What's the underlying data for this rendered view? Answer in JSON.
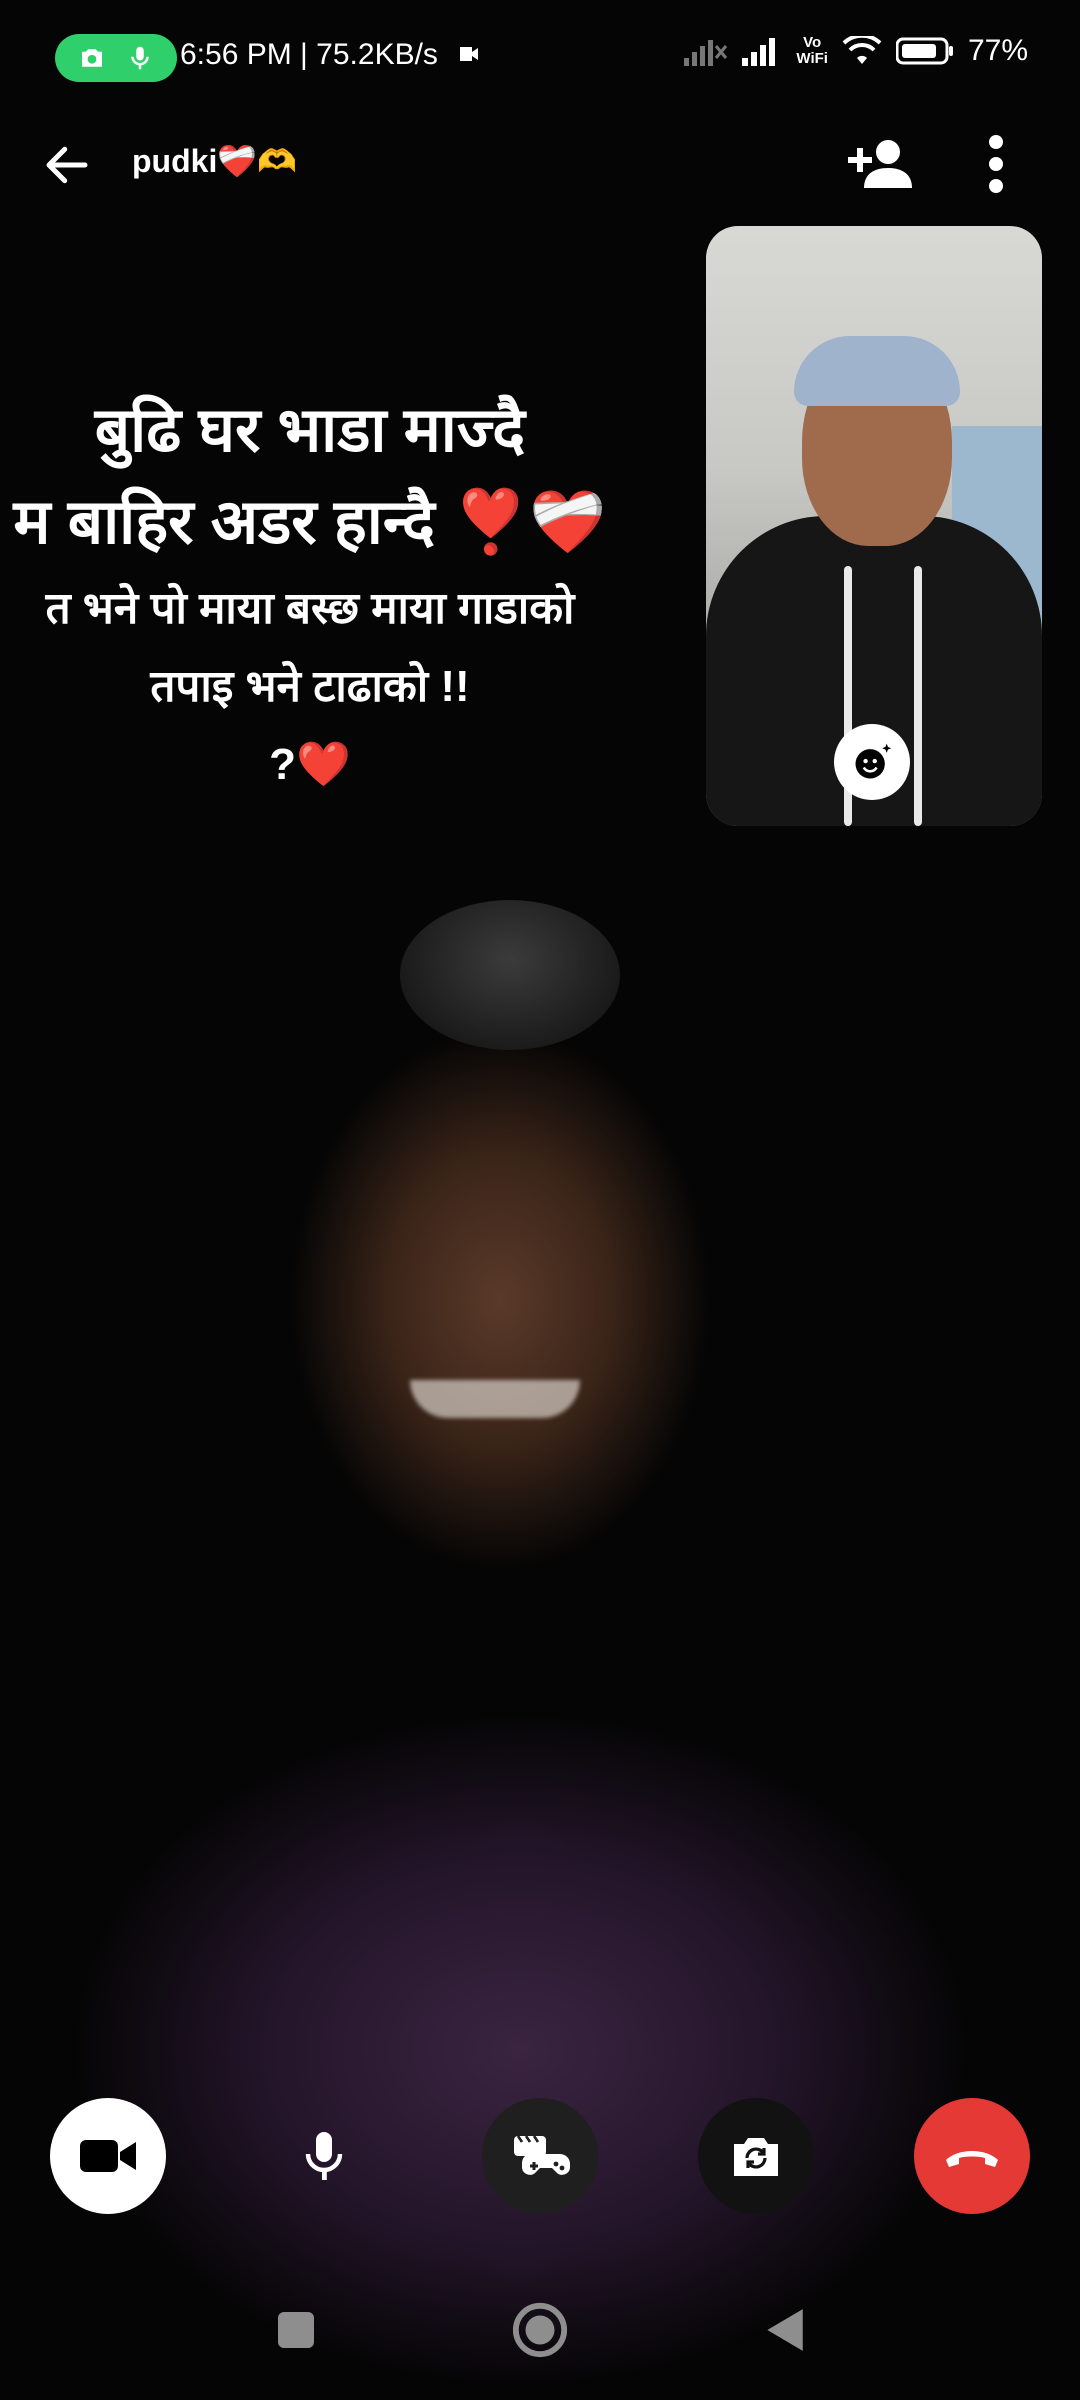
{
  "status_bar": {
    "time_speed": "6:56 PM | 75.2KB/s",
    "vowifi_line1": "Vo",
    "vowifi_line2": "WiFi",
    "battery": "77%"
  },
  "header": {
    "contact_name": "pudki❤️‍🩹🫶"
  },
  "overlay": {
    "line1": "बुढि घर भाडा माज्दै",
    "line2": "म बाहिर अडर हान्दै ❣️❤️‍🩹",
    "line3": "त भने पो माया बस्छ माया गाडाको",
    "line4": "तपाइ भने टाढाको !!",
    "line5": "?❤️"
  },
  "icons": {
    "back": "arrow-left-icon",
    "add_person": "add-person-icon",
    "more": "more-vertical-icon",
    "effects": "face-sparkle-icon",
    "video": "video-camera-icon",
    "mic": "microphone-icon",
    "games": "game-controller-icon",
    "flip": "flip-camera-icon",
    "end": "end-call-icon"
  },
  "colors": {
    "end_call": "#e53935",
    "recording_pill": "#2fcf6c"
  }
}
